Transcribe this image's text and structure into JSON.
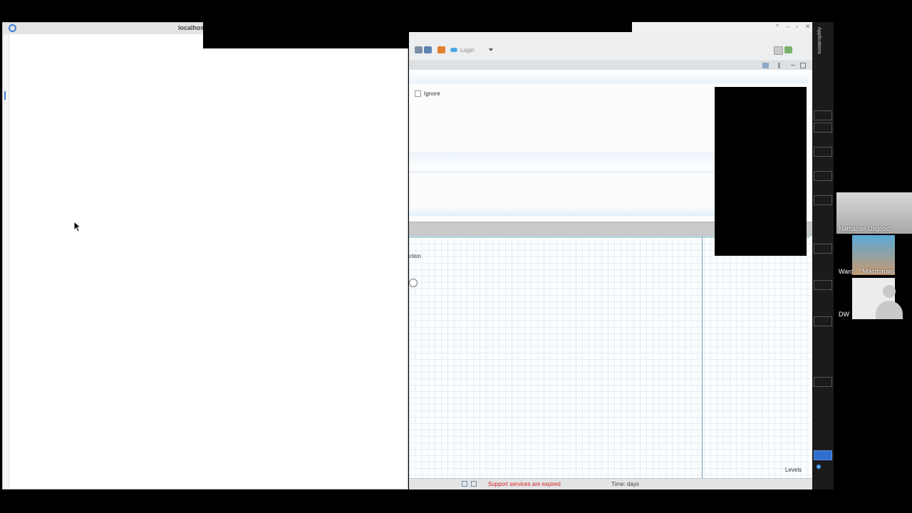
{
  "browser": {
    "title": "localhost"
  },
  "app": {
    "toolbar": {
      "login_label": "Login"
    },
    "panel": {
      "ignore_label": "Ignore"
    },
    "diagram": {
      "label": "ction",
      "levels_label": "Levels"
    },
    "statusbar": {
      "warning": "Support services are expired",
      "time": "Time: days"
    }
  },
  "dock": {
    "label": "Applications"
  },
  "participants": [
    {
      "name": "Nathaniel Osgood"
    },
    {
      "name": "Ward ... Macdonald"
    },
    {
      "name": "DW"
    }
  ],
  "colors": {
    "warning": "#dd2222",
    "accent": "#3f7fd8",
    "diagram_border": "#6a9fb8"
  }
}
